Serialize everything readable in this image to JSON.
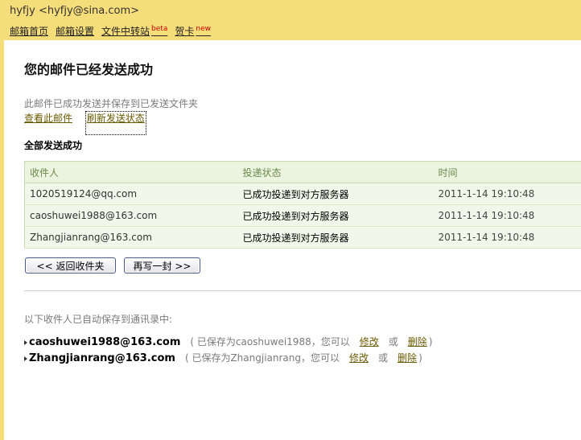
{
  "account": {
    "name": "hyfjy",
    "email": "<hyfjy@sina.com>"
  },
  "nav": [
    {
      "label": "邮箱首页",
      "badge": ""
    },
    {
      "label": "邮箱设置",
      "badge": ""
    },
    {
      "label": "文件中转站",
      "badge": "beta"
    },
    {
      "label": "贺卡",
      "badge": "new"
    }
  ],
  "main": {
    "title": "您的邮件已经发送成功",
    "note": "此邮件已成功发送并保存到已发送文件夹",
    "view_link": "查看此邮件",
    "refresh_link": "刷新发送状态",
    "all_success": "全部发送成功",
    "table": {
      "headers": [
        "收件人",
        "投递状态",
        "时间"
      ],
      "rows": [
        {
          "recipient": "1020519124@qq.com",
          "status": "已成功投递到对方服务器",
          "time": "2011-1-14 19:10:48"
        },
        {
          "recipient": "caoshuwei1988@163.com",
          "status": "已成功投递到对方服务器",
          "time": "2011-1-14 19:10:48"
        },
        {
          "recipient": "Zhangjianrang@163.com",
          "status": "已成功投递到对方服务器",
          "time": "2011-1-14 19:10:48"
        }
      ]
    },
    "back_button": "<< 返回收件夹",
    "compose_button": "再写一封 >>",
    "saved_note": "以下收件人已自动保存到通讯录中:",
    "saved_contacts": [
      {
        "email": "caoshuwei1988@163.com",
        "saved_as": "( 已保存为caoshuwei1988，您可以",
        "edit": "修改",
        "or": "或",
        "delete": "删除",
        "close": ")"
      },
      {
        "email": "Zhangjianrang@163.com",
        "saved_as": "( 已保存为Zhangjianrang，您可以",
        "edit": "修改",
        "or": "或",
        "delete": "删除",
        "close": ")"
      }
    ]
  }
}
